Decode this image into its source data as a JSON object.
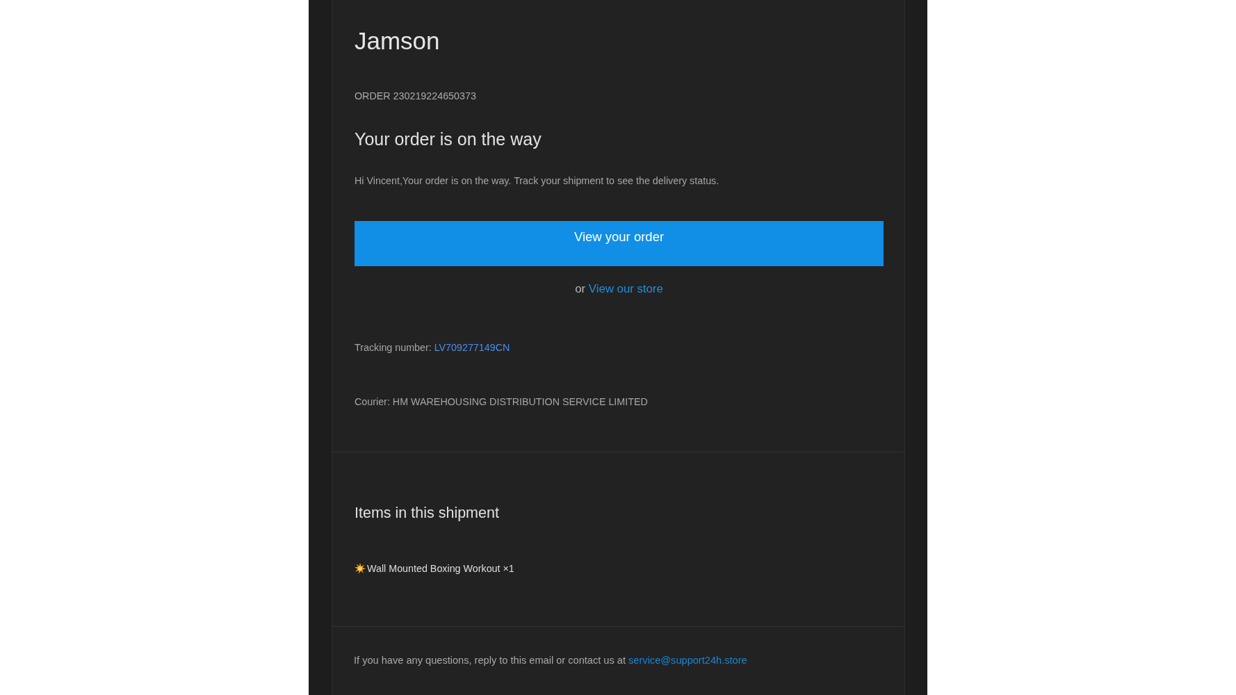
{
  "brand": {
    "name": "Jamson"
  },
  "order": {
    "number_label": "ORDER 230219224650373",
    "heading": "Your order is on the way",
    "message": "Hi Vincent,Your order is on the way. Track your shipment to see the delivery status.",
    "button": "View your order",
    "alt_prefix": "or",
    "alt_link": "View our store",
    "tracking_label": "Tracking number:",
    "tracking_number": "LV709277149CN",
    "courier": "Courier: HM WAREHOUSING DISTRIBUTION SERVICE LIMITED"
  },
  "shipment": {
    "heading": "Items in this shipment",
    "items": [
      {
        "name": "Wall Mounted Boxing Workout ×1"
      }
    ]
  },
  "footer": {
    "text": "If you have any questions, reply to this email or contact us at",
    "email": "service@support24h.store"
  }
}
